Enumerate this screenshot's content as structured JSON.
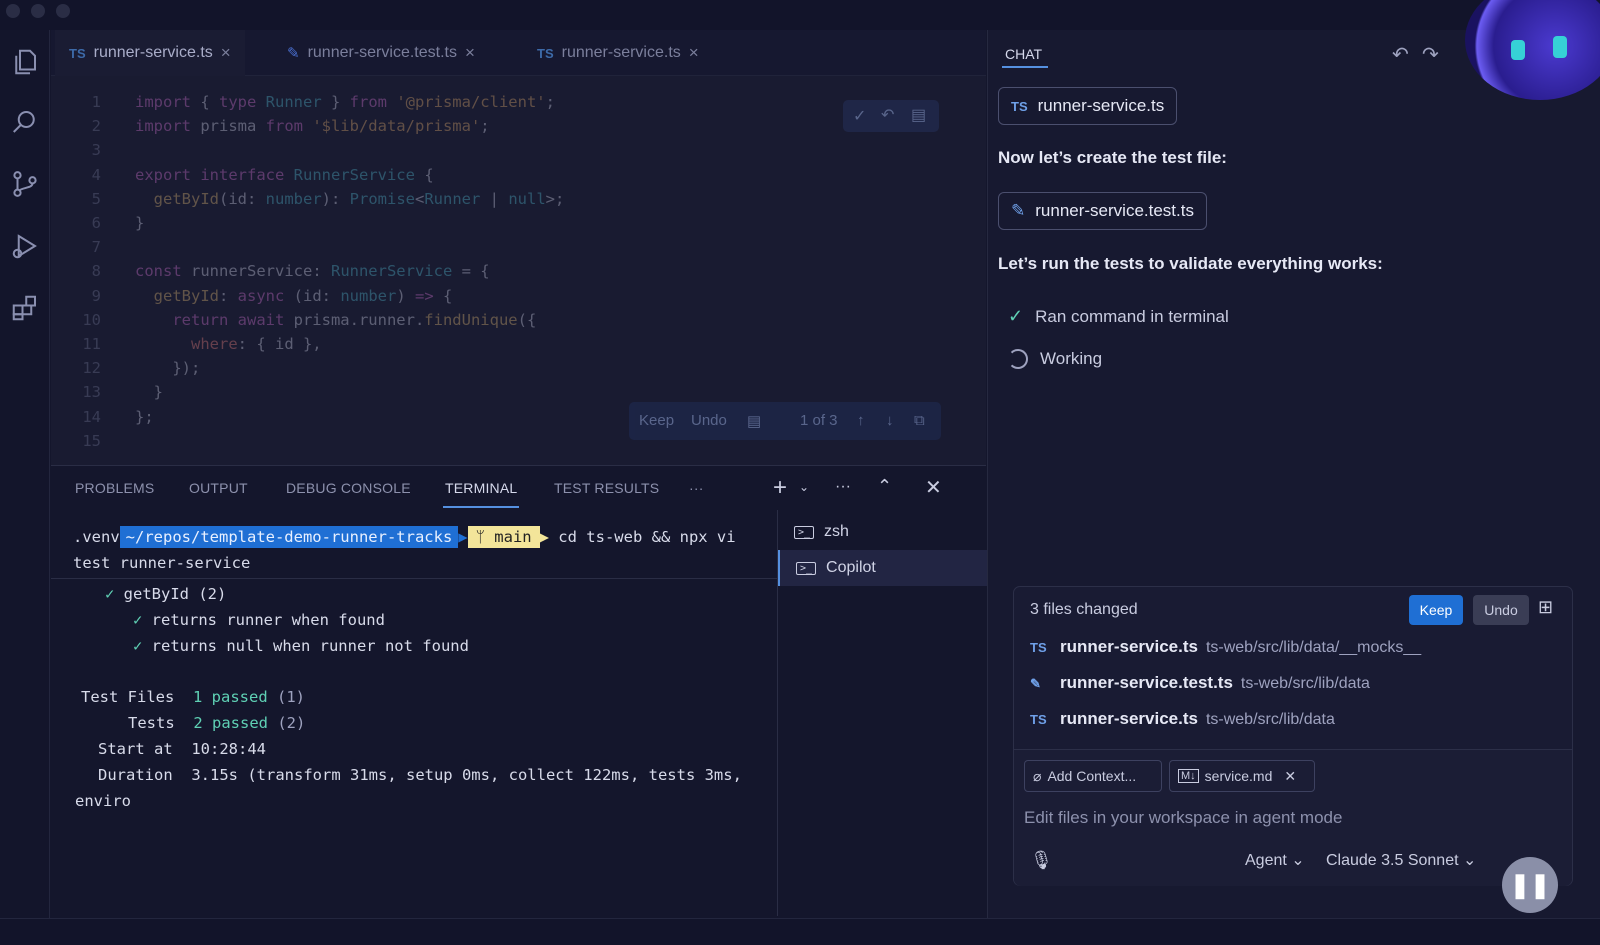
{
  "editor": {
    "tabs": [
      {
        "icon": "TS",
        "label": "runner-service.ts"
      },
      {
        "icon": "test-beaker-icon",
        "label": "runner-service.test.ts"
      },
      {
        "icon": "TS",
        "label": "runner-service.ts"
      }
    ],
    "lines": [
      {
        "n": "1",
        "text": "import { type Runner } from '@prisma/client';"
      },
      {
        "n": "2",
        "text": "import prisma from '$lib/data/prisma';"
      },
      {
        "n": "3",
        "text": ""
      },
      {
        "n": "4",
        "text": "export interface RunnerService {"
      },
      {
        "n": "5",
        "text": "  getById(id: number): Promise<Runner | null>;"
      },
      {
        "n": "6",
        "text": "}"
      },
      {
        "n": "7",
        "text": ""
      },
      {
        "n": "8",
        "text": "const runnerService: RunnerService = {"
      },
      {
        "n": "9",
        "text": "  getById: async (id: number) => {"
      },
      {
        "n": "10",
        "text": "    return await prisma.runner.findUnique({"
      },
      {
        "n": "11",
        "text": "      where: { id },"
      },
      {
        "n": "12",
        "text": "    });"
      },
      {
        "n": "13",
        "text": "  }"
      },
      {
        "n": "14",
        "text": "};"
      },
      {
        "n": "15",
        "text": ""
      }
    ],
    "diff_bar": {
      "keep": "Keep",
      "undo": "Undo",
      "counter": "1 of 3"
    }
  },
  "panel": {
    "tabs": [
      "PROBLEMS",
      "OUTPUT",
      "DEBUG CONSOLE",
      "TERMINAL",
      "TEST RESULTS"
    ],
    "more": "···",
    "terminal": {
      "venv": ".venv",
      "path": "~/repos/template-demo-runner-tracks",
      "branch": "main",
      "command_1": "cd ts-web && npx vi",
      "command_2": "test runner-service",
      "suite": "getById (2)",
      "test_1": "returns runner when found",
      "test_2": "returns null when runner not found",
      "files_label": "Test Files",
      "files_value": "1 passed",
      "files_count": "(1)",
      "tests_label": "Tests",
      "tests_value": "2 passed",
      "tests_count": "(2)",
      "start_label": "Start at",
      "start_value": "10:28:44",
      "duration_label": "Duration",
      "duration_value": "3.15s",
      "duration_detail": "(transform 31ms, setup 0ms, collect 122ms, tests 3ms,",
      "duration_wrap": "enviro"
    },
    "terminals": [
      "zsh",
      "Copilot"
    ]
  },
  "chat": {
    "title": "CHAT",
    "file_chip_1": "runner-service.ts",
    "file_chip_1_icon": "TS",
    "msg_1": "Now let’s create the test file:",
    "file_chip_2": "runner-service.test.ts",
    "msg_2": "Let’s run the tests to validate everything works:",
    "step_1": "Ran command in terminal",
    "step_2": "Working",
    "changes": {
      "title": "3 files changed",
      "keep": "Keep",
      "undo": "Undo",
      "files": [
        {
          "icon": "TS",
          "name": "runner-service.ts",
          "path": "ts-web/src/lib/data/__mocks__"
        },
        {
          "icon": "test-beaker-icon",
          "name": "runner-service.test.ts",
          "path": "ts-web/src/lib/data"
        },
        {
          "icon": "TS",
          "name": "runner-service.ts",
          "path": "ts-web/src/lib/data"
        }
      ]
    },
    "input": {
      "add_context": "Add Context...",
      "attachment": "service.md",
      "placeholder": "Edit files in your workspace in agent mode",
      "mode": "Agent",
      "model": "Claude 3.5 Sonnet"
    }
  },
  "colors": {
    "accent": "#1f6fd4",
    "pass": "#5fd0b4",
    "branch": "#f3e59a"
  }
}
